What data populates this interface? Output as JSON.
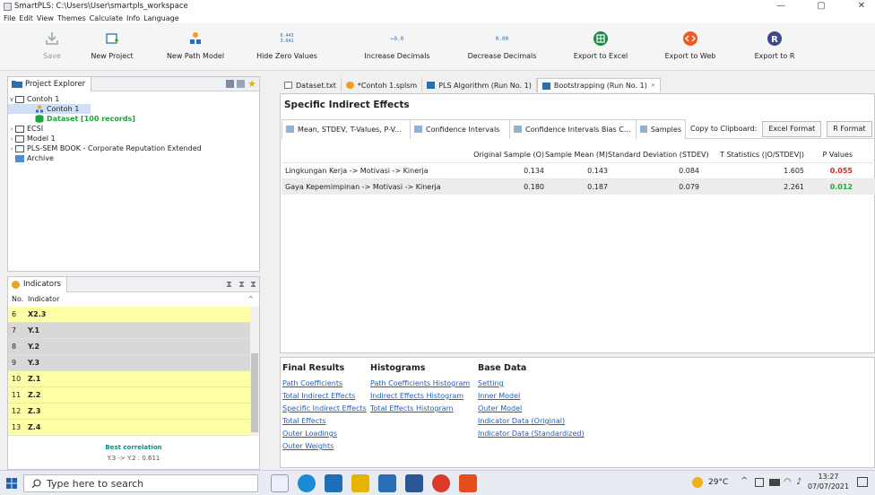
{
  "window": {
    "title": "SmartPLS: C:\\Users\\User\\smartpls_workspace",
    "minimize": "—",
    "maximize": "▢",
    "close": "✕"
  },
  "menu": [
    "File",
    "Edit",
    "View",
    "Themes",
    "Calculate",
    "Info",
    "Language"
  ],
  "toolbar": {
    "save": "Save",
    "new_project": "New Project",
    "new_path_model": "New Path Model",
    "hide_zero": "Hide Zero Values",
    "increase_decimals": "Increase Decimals",
    "decrease_decimals": "Decrease Decimals",
    "export_excel": "Export to Excel",
    "export_web": "Export to Web",
    "export_r": "Export to R",
    "hide_zero_icon_text": "0.443\n3.041",
    "increase_icon_text": "←0.0",
    "decrease_icon_text": "0.00"
  },
  "explorer": {
    "title": "Project Explorer",
    "items": [
      {
        "label": "Contoh 1",
        "chev": "∨"
      },
      {
        "label": "Contoh 1"
      },
      {
        "label": "Dataset [100 records]"
      },
      {
        "label": "ECSI",
        "chev": "›"
      },
      {
        "label": "Model 1",
        "chev": "›"
      },
      {
        "label": "PLS-SEM BOOK - Corporate Reputation Extended",
        "chev": "›"
      },
      {
        "label": "Archive"
      }
    ]
  },
  "indicators": {
    "title": "Indicators",
    "col_no": "No.",
    "col_indicator": "Indicator",
    "rows": [
      {
        "no": "6",
        "name": "X2.3"
      },
      {
        "no": "7",
        "name": "Y.1"
      },
      {
        "no": "8",
        "name": "Y.2"
      },
      {
        "no": "9",
        "name": "Y.3"
      },
      {
        "no": "10",
        "name": "Z.1"
      },
      {
        "no": "11",
        "name": "Z.2"
      },
      {
        "no": "12",
        "name": "Z.3"
      },
      {
        "no": "13",
        "name": "Z.4"
      }
    ],
    "best_correlation_label": "Best correlation",
    "best_correlation_value": "Y.3 -> Y.2 : 0.611"
  },
  "doc_tabs": [
    {
      "label": "Dataset.txt"
    },
    {
      "label": "*Contoh 1.splsm"
    },
    {
      "label": "PLS Algorithm (Run No. 1)"
    },
    {
      "label": "Bootstrapping (Run No. 1)",
      "close": "✕"
    }
  ],
  "report": {
    "heading": "Specific Indirect Effects",
    "subtabs": [
      "Mean, STDEV, T-Values, P-V...",
      "Confidence Intervals",
      "Confidence Intervals Bias C...",
      "Samples"
    ],
    "copy_label": "Copy to Clipboard:",
    "excel_format": "Excel Format",
    "r_format": "R Format",
    "columns": [
      "",
      "Original Sample (O)",
      "Sample Mean (M)",
      "Standard Deviation (STDEV)",
      "T Statistics (|O/STDEV|)",
      "P Values"
    ],
    "rows": [
      {
        "path": "Lingkungan Kerja -> Motivasi -> Kinerja",
        "o": "0.134",
        "m": "0.143",
        "stdev": "0.084",
        "t": "1.605",
        "p": "0.055",
        "p_color": "#e02020"
      },
      {
        "path": "Gaya Kepemimpinan -> Motivasi -> Kinerja",
        "o": "0.180",
        "m": "0.187",
        "stdev": "0.079",
        "t": "2.261",
        "p": "0.012",
        "p_color": "#22a83a"
      }
    ]
  },
  "nav": {
    "final_results": {
      "title": "Final Results",
      "links": [
        "Path Coefficients",
        "Total Indirect Effects",
        "Specific Indirect Effects",
        "Total Effects",
        "Outer Loadings",
        "Outer Weights"
      ]
    },
    "histograms": {
      "title": "Histograms",
      "links": [
        "Path Coefficients Histogram",
        "Indirect Effects Histogram",
        "Total Effects Histogram"
      ]
    },
    "base_data": {
      "title": "Base Data",
      "links": [
        "Setting",
        "Inner Model",
        "Outer Model",
        "Indicator Data (Original)",
        "Indicator Data (Standardized)"
      ]
    }
  },
  "taskbar": {
    "search_placeholder": "Type here to search",
    "weather": "29°C",
    "time": "13:27",
    "date": "07/07/2021"
  },
  "colors": {
    "highlight_yellow": "#ffffa8",
    "row_grey": "#d8d8d8",
    "dataset_green": "#1aa63a",
    "link_blue": "#1f5fbf"
  }
}
